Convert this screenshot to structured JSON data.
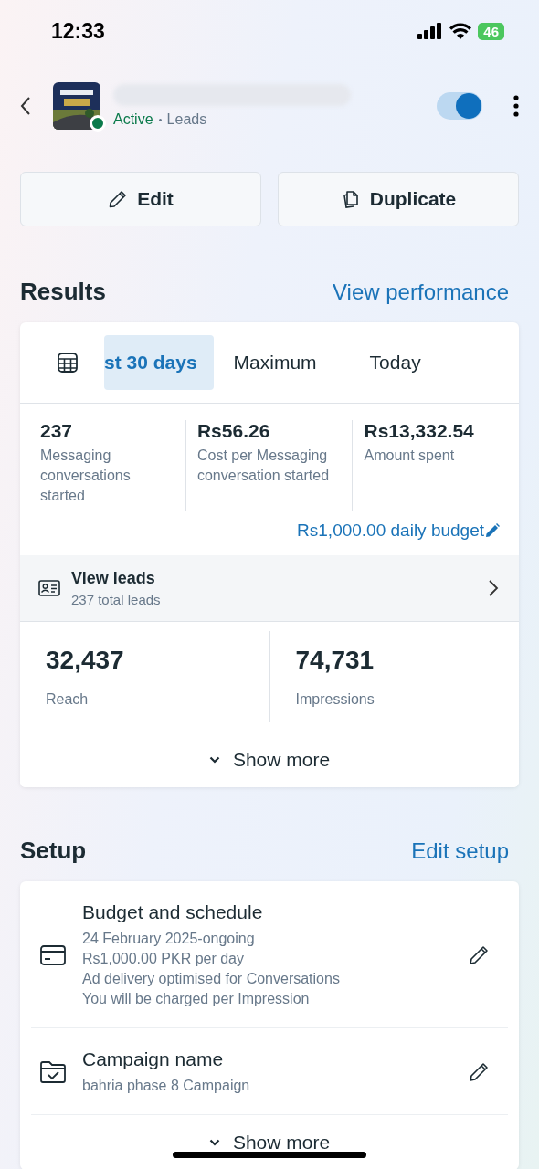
{
  "status_bar": {
    "time": "12:33",
    "battery": "46"
  },
  "header": {
    "status": "Active",
    "objective": "Leads",
    "toggle_on": true
  },
  "actions": [
    {
      "kind": "edit",
      "label": "Edit"
    },
    {
      "kind": "duplicate",
      "label": "Duplicate"
    }
  ],
  "results": {
    "title": "Results",
    "link": "View performance",
    "tabs": [
      {
        "label": "st 30 days",
        "selected": true
      },
      {
        "label": "Maximum",
        "selected": false
      },
      {
        "label": "Today",
        "selected": false
      }
    ],
    "metrics": [
      {
        "value": "237",
        "label": "Messaging conversations started"
      },
      {
        "value": "Rs56.26",
        "label": "Cost per Messaging conversation started"
      },
      {
        "value": "Rs13,332.54",
        "label": "Amount spent"
      }
    ],
    "budget": "Rs1,000.00 daily budget",
    "leads": {
      "title": "View leads",
      "subtitle": "237 total leads"
    },
    "totals": [
      {
        "value": "32,437",
        "label": "Reach"
      },
      {
        "value": "74,731",
        "label": "Impressions"
      }
    ],
    "show_more": "Show more"
  },
  "setup": {
    "title": "Setup",
    "link": "Edit setup",
    "items": [
      {
        "kind": "budget",
        "title": "Budget and schedule",
        "lines": [
          "24 February 2025-ongoing",
          "Rs1,000.00 PKR per day",
          "Ad delivery optimised for Conversations",
          "You will be charged per Impression"
        ]
      },
      {
        "kind": "campaign",
        "title": "Campaign name",
        "lines": [
          "bahria phase 8 Campaign"
        ]
      }
    ],
    "show_more": "Show more"
  }
}
